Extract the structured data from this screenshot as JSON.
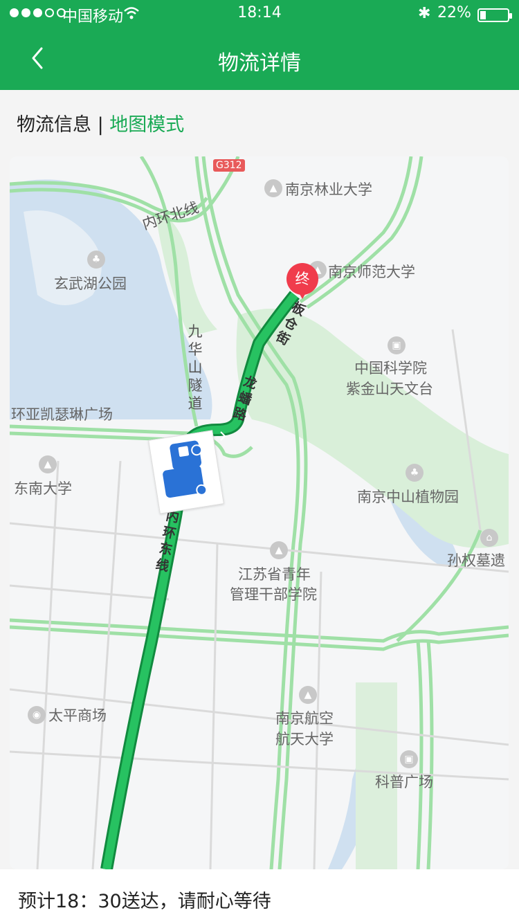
{
  "status_bar": {
    "carrier": "中国移动",
    "time": "18:14",
    "battery": "22%",
    "battery_level": 0.22
  },
  "header": {
    "title": "物流详情",
    "back_icon": "chevron-left-icon"
  },
  "mode": {
    "info_label": "物流信息",
    "separator": "|",
    "map_label": "地图模式"
  },
  "map": {
    "highway_badge": "G312",
    "end_marker": "终",
    "labels": {
      "njfu": "南京林业大学",
      "ring_north": "内环北线",
      "xuanwu": "玄武湖公园",
      "njnu": "南京师范大学",
      "jiuhua_1": "九",
      "jiuhua_2": "华",
      "jiuhua_3": "山",
      "jiuhua_4": "隧",
      "jiuhua_5": "道",
      "cas_1": "中国科学院",
      "cas_2": "紫金山天文台",
      "kerry": "环亚凯瑟琳广场",
      "seu": "东南大学",
      "botanical": "南京中山植物园",
      "sunquan": "孙权墓遗",
      "youth_1": "江苏省青年",
      "youth_2": "管理干部学院",
      "taiping": "太平商场",
      "nuaa_1": "南京航空",
      "nuaa_2": "航天大学",
      "kepu": "科普广场"
    },
    "road_labels": {
      "bancang_1": "板",
      "bancang_2": "仓",
      "bancang_3": "街",
      "longpan_1": "龙",
      "longpan_2": "蟠",
      "longpan_3": "路",
      "ring_east_1": "内",
      "ring_east_2": "环",
      "ring_east_3": "东",
      "ring_east_4": "线"
    }
  },
  "footer": {
    "eta": "预计18：30送达，请耐心等待"
  }
}
